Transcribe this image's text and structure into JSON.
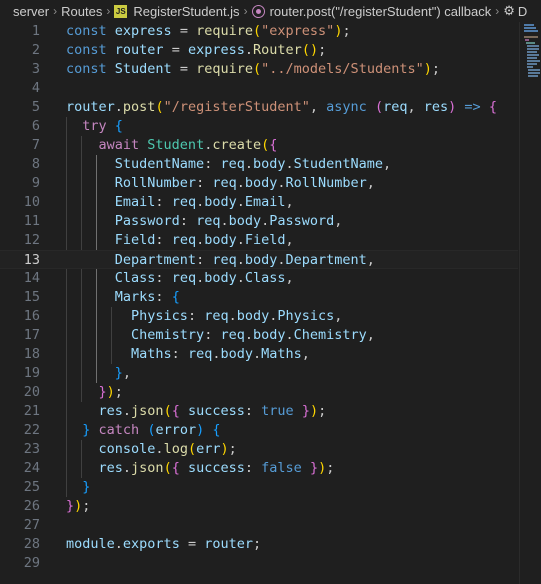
{
  "breadcrumb": {
    "folder1": "server",
    "folder2": "Routes",
    "file_badge": "JS",
    "file": "RegisterStudent.js",
    "symbol": "router.post(\"/registerStudent\") callback",
    "overflow": "D"
  },
  "editor": {
    "current_line": 13,
    "lines": [
      {
        "n": "1"
      },
      {
        "n": "2"
      },
      {
        "n": "3"
      },
      {
        "n": "4"
      },
      {
        "n": "5"
      },
      {
        "n": "6"
      },
      {
        "n": "7"
      },
      {
        "n": "8"
      },
      {
        "n": "9"
      },
      {
        "n": "10"
      },
      {
        "n": "11"
      },
      {
        "n": "12"
      },
      {
        "n": "13"
      },
      {
        "n": "14"
      },
      {
        "n": "15"
      },
      {
        "n": "16"
      },
      {
        "n": "17"
      },
      {
        "n": "18"
      },
      {
        "n": "19"
      },
      {
        "n": "20"
      },
      {
        "n": "21"
      },
      {
        "n": "22"
      },
      {
        "n": "23"
      },
      {
        "n": "24"
      },
      {
        "n": "25"
      },
      {
        "n": "26"
      },
      {
        "n": "27"
      },
      {
        "n": "28"
      },
      {
        "n": "29"
      }
    ],
    "tokens": {
      "const": "const",
      "express": "express",
      "router": "router",
      "Student": "Student",
      "require": "require",
      "str_express": "\"express\"",
      "Router": "Router",
      "str_models": "\"../models/Students\"",
      "post": "post",
      "str_route": "\"/registerStudent\"",
      "async": "async",
      "req": "req",
      "res": "res",
      "try": "try",
      "await": "await",
      "create": "create",
      "body": "body",
      "StudentName": "StudentName",
      "RollNumber": "RollNumber",
      "Email": "Email",
      "Password": "Password",
      "Field": "Field",
      "Department": "Department",
      "Class": "Class",
      "Marks": "Marks",
      "Physics": "Physics",
      "Chemistry": "Chemistry",
      "Maths": "Maths",
      "json": "json",
      "success": "success",
      "true": "true",
      "false": "false",
      "catch": "catch",
      "error": "error",
      "console": "console",
      "log": "log",
      "err": "err",
      "module": "module",
      "exports": "exports"
    }
  },
  "colors": {
    "background": "#1f1f1f",
    "keyword": "#569cd6",
    "control": "#c586c0",
    "variable": "#9cdcfe",
    "class": "#4ec9b0",
    "function": "#dcdcaa",
    "string": "#ce9178",
    "bracket1": "#ffd700",
    "bracket2": "#da70d6",
    "bracket3": "#179fff"
  }
}
